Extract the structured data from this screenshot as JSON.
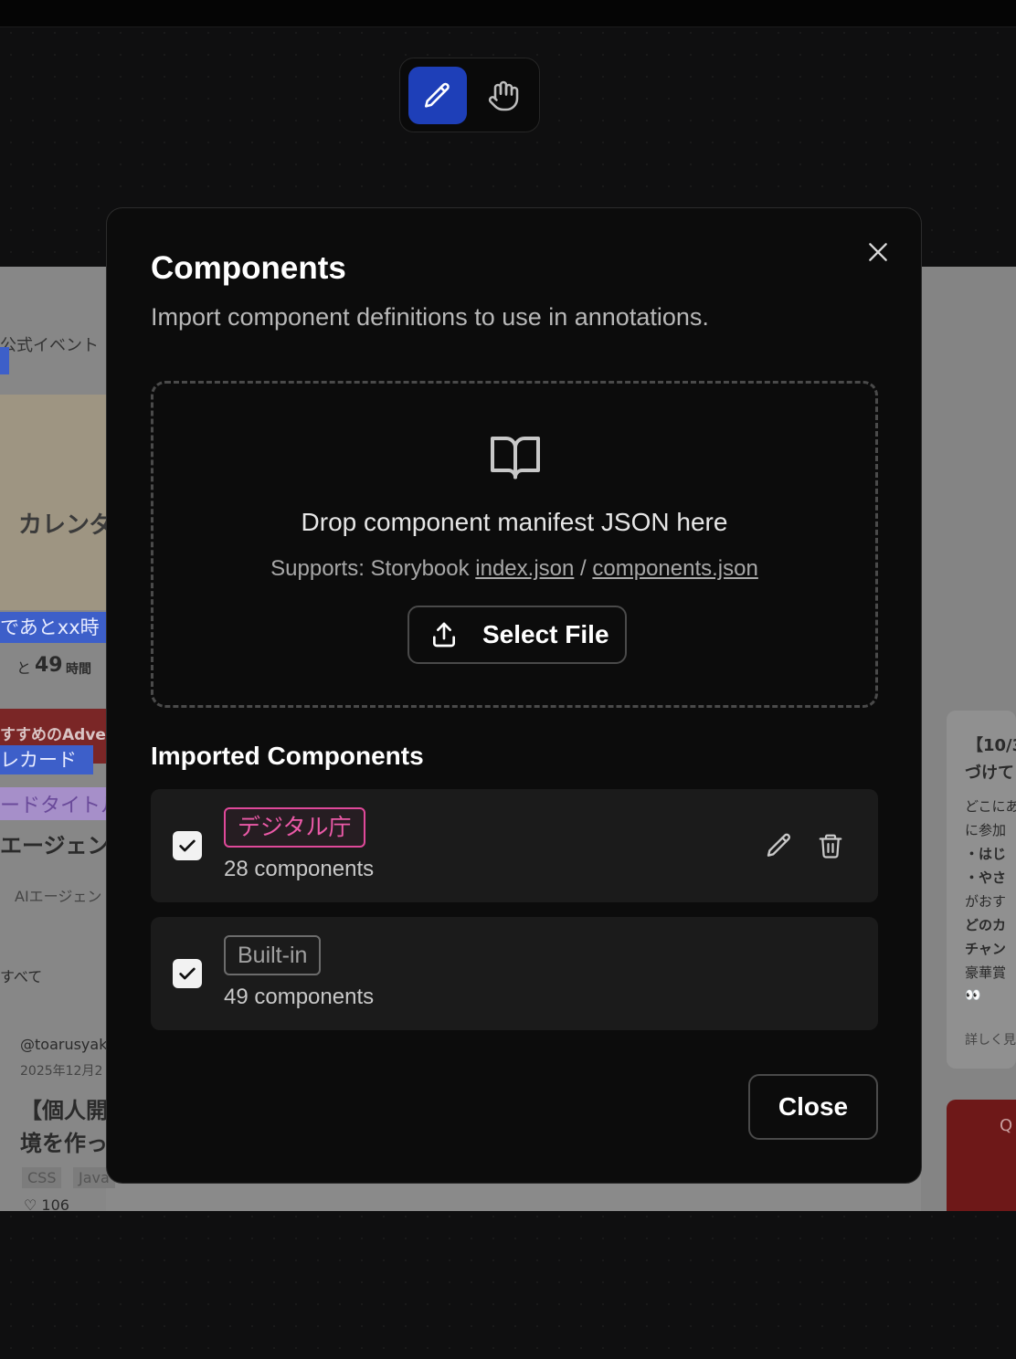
{
  "toolbar": {
    "tools": [
      {
        "name": "pen",
        "icon": "pencil-icon",
        "active": true
      },
      {
        "name": "hand",
        "icon": "hand-icon",
        "active": false
      }
    ]
  },
  "background_page": {
    "texts": {
      "event": "公式イベント",
      "calendar": "カレンダ",
      "until": "であとxx時",
      "remain_prefix": "と",
      "remain_num": "49",
      "remain_unit": "時間",
      "recommend": "すすめのAdve",
      "calcard": "レカード",
      "cardtitle": "ードタイトル",
      "agent": "エージェン",
      "ai_agent": "AIエージェン",
      "all": "すべて",
      "user": "@toarusyak",
      "date": "2025年12月2",
      "post_title_1": "【個人開",
      "post_title_2": "境を作っ",
      "tag_css": "CSS",
      "tag_java": "Java",
      "likes": "♡ 106",
      "right_title_1": "【10/3",
      "right_title_2": "づけて",
      "right_l1": "どこにあ",
      "right_l2": "に参加",
      "right_l3": "・はじ",
      "right_l4": "・やさ",
      "right_l5": "がおす",
      "right_l6": "どのカ",
      "right_l7": "チャン",
      "right_l8": "豪華賞",
      "right_l9": "👀",
      "right_more": "詳しく見",
      "right_q": "Q"
    }
  },
  "modal": {
    "title": "Components",
    "subtitle": "Import component definitions to use in annotations.",
    "close_icon": "close-icon",
    "dropzone": {
      "icon": "book-open-icon",
      "text": "Drop component manifest JSON here",
      "supports_prefix": "Supports: Storybook",
      "supports_link1": "index.json",
      "supports_sep": "/",
      "supports_link2": "components.json",
      "button_label": "Select File",
      "button_icon": "upload-icon"
    },
    "imported_title": "Imported Components",
    "components": [
      {
        "label": "デジタル庁",
        "count": "28 components",
        "checked": true,
        "tag_color": "#e0499a",
        "editable": true
      },
      {
        "label": "Built-in",
        "count": "49 components",
        "checked": true,
        "tag_color": "#6c6c6c",
        "editable": false
      }
    ],
    "close_label": "Close"
  }
}
